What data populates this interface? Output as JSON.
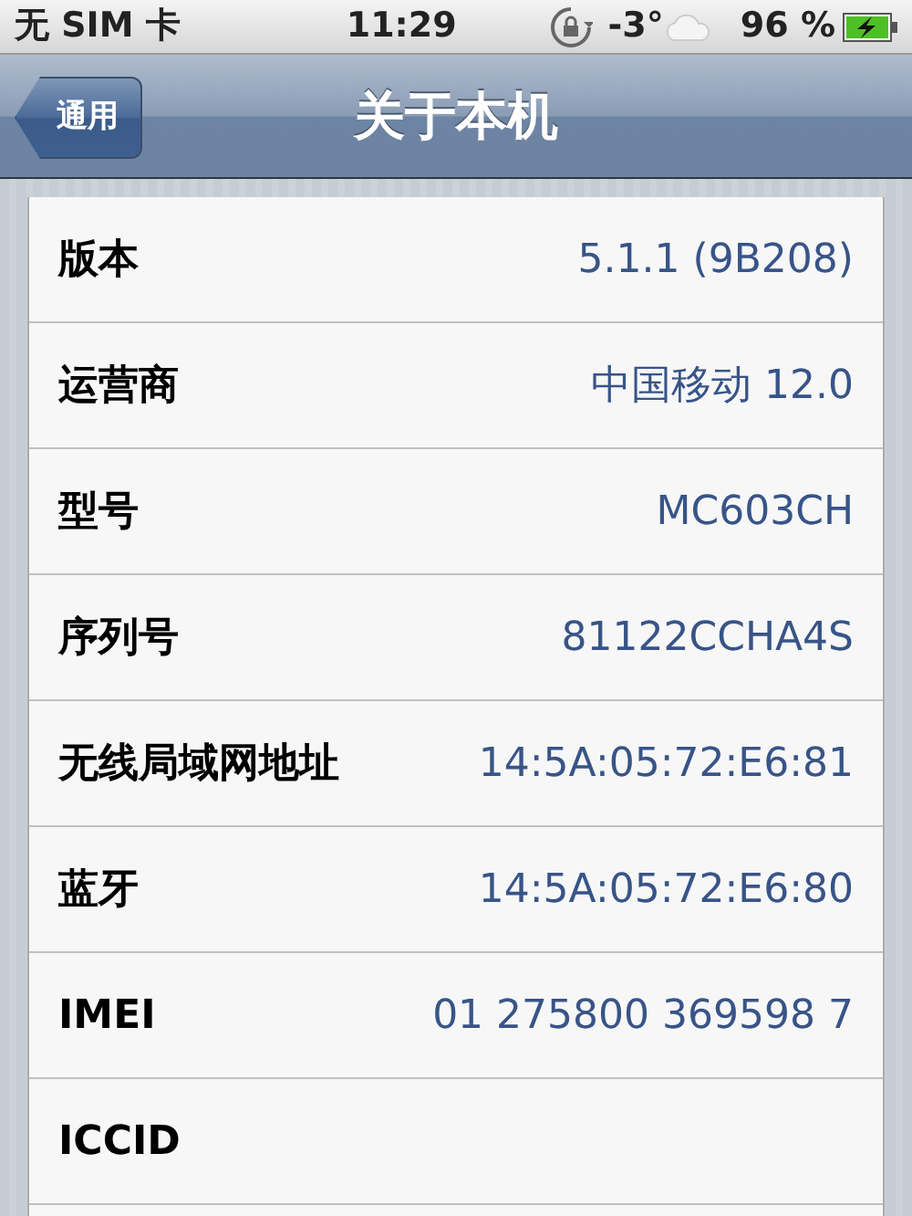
{
  "status_bar": {
    "carrier": "无 SIM 卡",
    "time": "11:29",
    "temperature": "-3°",
    "battery": "96 %"
  },
  "nav_bar": {
    "back": "通用",
    "title": "关于本机"
  },
  "rows": [
    {
      "label": "版本",
      "value": "5.1.1 (9B208)"
    },
    {
      "label": "运营商",
      "value": "中国移动 12.0"
    },
    {
      "label": "型号",
      "value": "MC603CH"
    },
    {
      "label": "序列号",
      "value": "81122CCHA4S"
    },
    {
      "label": "无线局域网地址",
      "value": "14:5A:05:72:E6:81"
    },
    {
      "label": "蓝牙",
      "value": "14:5A:05:72:E6:80"
    },
    {
      "label": "IMEI",
      "value": "01 275800 369598 7"
    },
    {
      "label": "ICCID"
    }
  ]
}
